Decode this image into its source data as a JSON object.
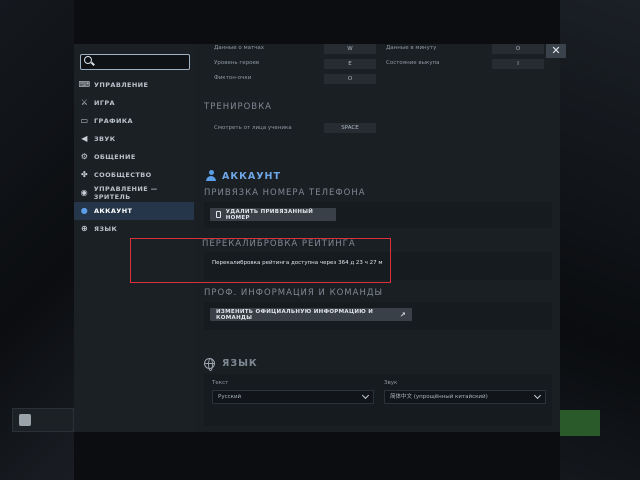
{
  "sidebar": {
    "search_value": "",
    "items": [
      {
        "label": "УПРАВЛЕНИЕ",
        "icon": "gamepad-icon"
      },
      {
        "label": "ИГРА",
        "icon": "sword-icon"
      },
      {
        "label": "ГРАФИКА",
        "icon": "monitor-icon"
      },
      {
        "label": "ЗВУК",
        "icon": "speaker-icon"
      },
      {
        "label": "ОБЩЕНИЕ",
        "icon": "gear-icon"
      },
      {
        "label": "СООБЩЕСТВО",
        "icon": "community-icon"
      },
      {
        "label": "УПРАВЛЕНИЕ — ЗРИТЕЛЬ",
        "icon": "eye-icon"
      },
      {
        "label": "АККАУНТ",
        "icon": "user-icon"
      },
      {
        "label": "ЯЗЫК",
        "icon": "globe-icon"
      }
    ],
    "active_index": 7
  },
  "top_rows": {
    "left": [
      {
        "label": "Данные о матчах",
        "key": "W"
      },
      {
        "label": "Уровень героев",
        "key": "E"
      },
      {
        "label": "Фиктон-очки",
        "key": "O"
      }
    ],
    "right": [
      {
        "label": "Данные в минуту",
        "key": "O"
      },
      {
        "label": "Состояние выкупа",
        "key": "I"
      }
    ]
  },
  "training": {
    "title": "ТРЕНИРОВКА",
    "row_label": "Смотреть от лица ученика",
    "row_key": "SPACE"
  },
  "account": {
    "title": "АККАУНТ",
    "phone_title": "ПРИВЯЗКА НОМЕРА ТЕЛЕФОНА",
    "phone_button": "УДАЛИТЬ ПРИВЯЗАННЫЙ НОМЕР",
    "recal_title": "ПЕРЕКАЛИБРОВКА РЕЙТИНГА",
    "recal_text": "Перекалибровка рейтинга доступна через 364 д 23 ч 27 м",
    "pro_title": "ПРОФ. ИНФОРМАЦИЯ И КОМАНДЫ",
    "pro_button": "ИЗМЕНИТЬ ОФИЦИАЛЬНУЮ ИНФОРМАЦИЮ И КОМАНДЫ"
  },
  "language": {
    "title": "ЯЗЫК",
    "text_label": "Текст",
    "text_value": "Русский",
    "audio_label": "Звук",
    "audio_value": "简体中文 (упрощённый китайский)"
  },
  "colors": {
    "accent": "#6fa6e6",
    "highlight": "#d8313a",
    "active_nav": "#25364a"
  }
}
